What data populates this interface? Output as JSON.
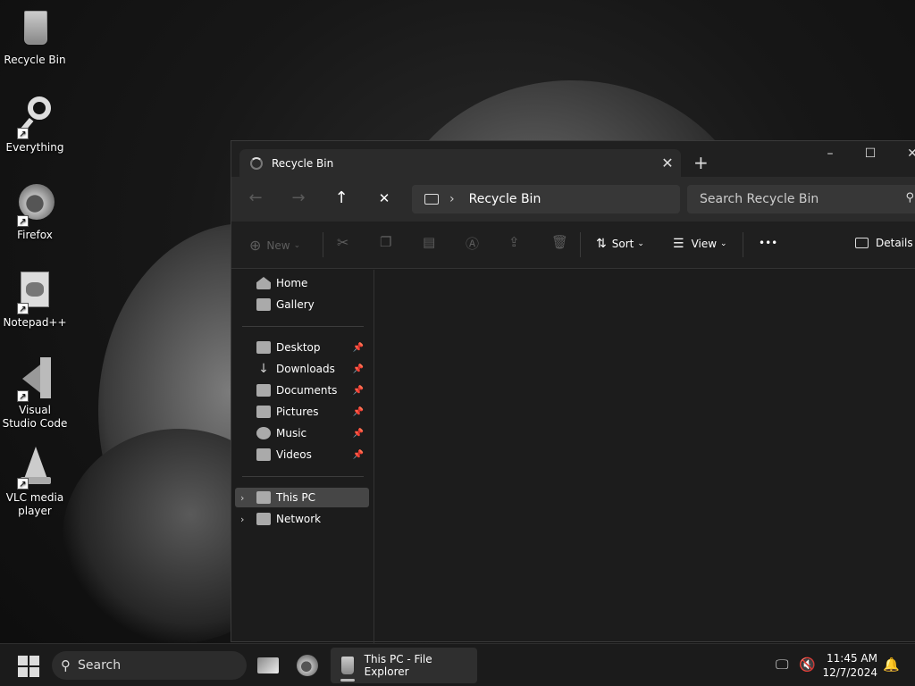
{
  "desktop": {
    "icons": [
      {
        "label": "Recycle Bin",
        "icon": "recycle-bin-icon"
      },
      {
        "label": "Everything",
        "icon": "magnifier-icon"
      },
      {
        "label": "Firefox",
        "icon": "firefox-icon"
      },
      {
        "label": "Notepad++",
        "icon": "notepadpp-icon"
      },
      {
        "label": "Visual Studio Code",
        "icon": "vscode-icon"
      },
      {
        "label": "VLC media player",
        "icon": "vlc-cone-icon"
      }
    ]
  },
  "window": {
    "tab_title": "Recycle Bin",
    "new_tab": "+",
    "controls": {
      "minimize": "–",
      "maximize": "☐",
      "close": "✕"
    },
    "nav": {
      "back": "←",
      "forward": "→",
      "up": "↑",
      "stop": "✕"
    },
    "address": {
      "location": "Recycle Bin",
      "separator": "›"
    },
    "search_placeholder": "Search Recycle Bin",
    "toolbar": {
      "new_label": "New",
      "sort_label": "Sort",
      "view_label": "View",
      "more_label": "•••",
      "details_label": "Details"
    },
    "sidebar": {
      "quick": [
        {
          "label": "Home"
        },
        {
          "label": "Gallery"
        }
      ],
      "pinned": [
        {
          "label": "Desktop"
        },
        {
          "label": "Downloads"
        },
        {
          "label": "Documents"
        },
        {
          "label": "Pictures"
        },
        {
          "label": "Music"
        },
        {
          "label": "Videos"
        }
      ],
      "locations": [
        {
          "label": "This PC",
          "selected": true
        },
        {
          "label": "Network",
          "selected": false
        }
      ]
    }
  },
  "taskbar": {
    "search_label": "Search",
    "explorer_task_label": "This PC - File Explorer",
    "time": "11:45 AM",
    "date": "12/7/2024"
  },
  "colors": {
    "accent": "#464646",
    "window_bg": "#1c1c1c",
    "taskbar_bg": "#1b1b1b"
  }
}
